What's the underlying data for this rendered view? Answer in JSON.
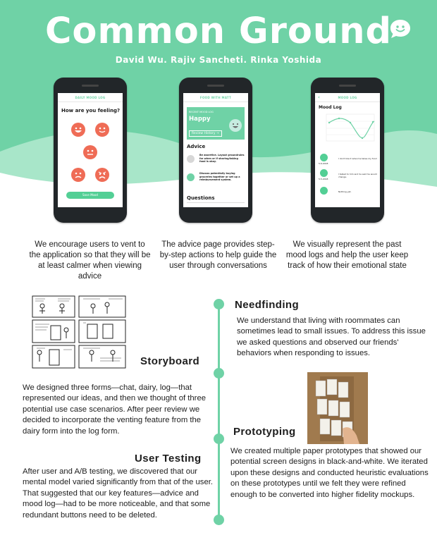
{
  "header": {
    "title": "Common Ground",
    "authors": "David Wu. Rajiv Sancheti. Rinka Yoshida"
  },
  "colors": {
    "accent": "#6fd2a6",
    "hero_bg": "#6fd2a6",
    "face_red": "#ef6c56",
    "phone": "#222629"
  },
  "phones": {
    "mood": {
      "bar": "DAILY MOOD LOG",
      "question": "How are you feeling?",
      "save": "Save Mood"
    },
    "advice": {
      "bar": "FOOD WITH MATT",
      "recent_label": "RECENT MOOD LOG",
      "recent_value": "Happy",
      "review": "Review History",
      "advice_heading": "Advice",
      "tip1": "Be assertive. Layout groundrules for when or if sharing/taking food is okay.",
      "tip2": "Discuss potentially buying groceries together or set up a reimbursement system.",
      "questions_heading": "Questions"
    },
    "log": {
      "bar": "MOOD LOG",
      "heading": "Mood Log",
      "entries": [
        {
          "date": "5.6.2018",
          "text": "I don't like it when he takes my food"
        },
        {
          "date": "5.5.2018",
          "text": "I talked to him and he said he would change."
        },
        {
          "date": "",
          "text": "Nothing yet."
        }
      ]
    }
  },
  "captions": {
    "left": "We encourage users to vent to the application so that they will be at least calmer when viewing advice",
    "middle": "The advice page provides step-by-step actions to help guide the user through conversations",
    "right": "We visually represent the past mood logs and help the user keep track of how their emotional state"
  },
  "sections": {
    "needfinding": {
      "title": "Needfinding",
      "text": "We understand that living with roommates can sometimes lead to small issues. To address this issue we asked questions and observed our friends' behaviors when responding to issues."
    },
    "storyboard": {
      "title": "Storyboard",
      "text": "We designed three forms—chat, dairy, log—that represented our ideas, and then we thought of three potential use case scenarios. After peer review we decided to incorporate the venting feature from the dairy form into the log form."
    },
    "prototyping": {
      "title": "Prototyping",
      "text": "We created multiple paper prototypes that showed our potential screen designs in black-and-white. We iterated upon these designs and conducted heuristic evaluations on these prototypes until we felt they were refined enough to be converted into higher fidelity mockups."
    },
    "user_testing": {
      "title": "User Testing",
      "text": "After user and A/B testing, we discovered that our mental model varied significantly from that of the user. That suggested that our key features—advice and mood log—had to be more noticeable, and that some redundant buttons need to be deleted."
    }
  }
}
